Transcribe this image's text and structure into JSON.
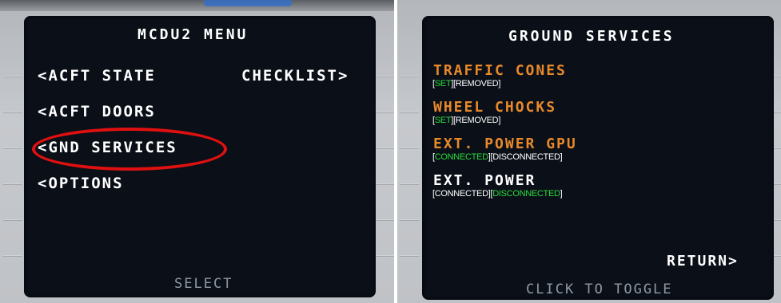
{
  "mcdu_menu": {
    "title": "MCDU2 MENU",
    "items": [
      {
        "label": "<ACFT STATE"
      },
      {
        "label": "<ACFT DOORS"
      },
      {
        "label": "<GND SERVICES"
      },
      {
        "label": "<OPTIONS"
      }
    ],
    "checklist_label": "CHECKLIST>",
    "footer": "SELECT"
  },
  "ground_services": {
    "title": "GROUND SERVICES",
    "traffic_cones": {
      "heading": "TRAFFIC CONES",
      "opt1": "SET",
      "opt2": "REMOVED"
    },
    "wheel_chocks": {
      "heading": "WHEEL CHOCKS",
      "opt1": "SET",
      "opt2": "REMOVED"
    },
    "ext_power_gpu": {
      "heading": "EXT. POWER GPU",
      "opt1": "CONNECTED",
      "opt2": "DISCONNECTED"
    },
    "ext_power": {
      "heading": "EXT. POWER",
      "opt1": "CONNECTED",
      "opt2": "DISCONNECTED"
    },
    "return_label": "RETURN>",
    "footer": "CLICK TO TOGGLE"
  },
  "colors": {
    "screen_bg": "#0a0f18",
    "amber": "#e8892a",
    "green": "#2bdc3c",
    "highlight": "#e01010"
  }
}
